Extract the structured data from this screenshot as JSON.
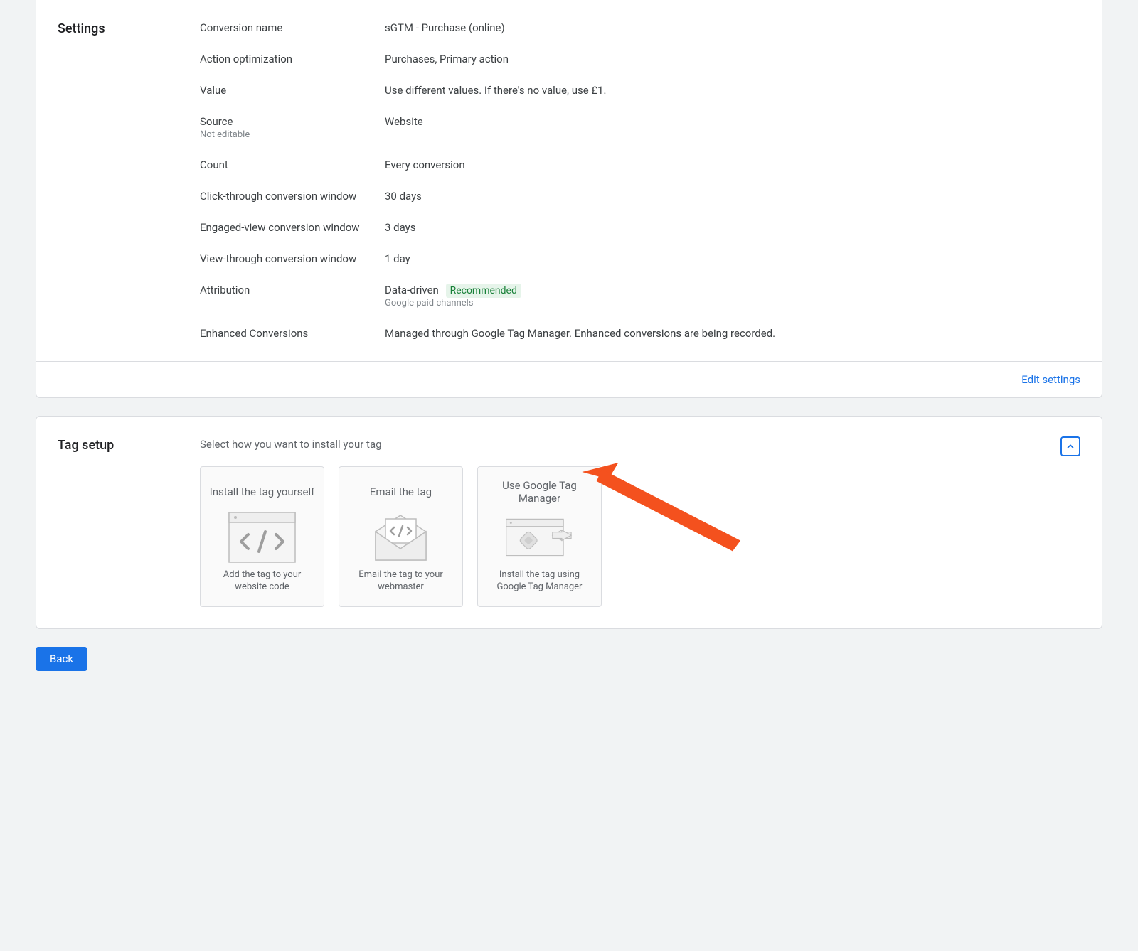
{
  "settings": {
    "title": "Settings",
    "rows": {
      "conversion_name": {
        "label": "Conversion name",
        "value": "sGTM - Purchase (online)"
      },
      "action_optimization": {
        "label": "Action optimization",
        "value": "Purchases, Primary action"
      },
      "value": {
        "label": "Value",
        "value": "Use different values. If there's no value, use £1."
      },
      "source": {
        "label": "Source",
        "sub": "Not editable",
        "value": "Website"
      },
      "count": {
        "label": "Count",
        "value": "Every conversion"
      },
      "click_through": {
        "label": "Click-through conversion window",
        "value": "30 days"
      },
      "engaged_view": {
        "label": "Engaged-view conversion window",
        "value": "3 days"
      },
      "view_through": {
        "label": "View-through conversion window",
        "value": "1 day"
      },
      "attribution": {
        "label": "Attribution",
        "value": "Data-driven",
        "badge": "Recommended",
        "sub": "Google paid channels"
      },
      "enhanced": {
        "label": "Enhanced Conversions",
        "value": "Managed through Google Tag Manager. Enhanced conversions are being recorded."
      }
    },
    "edit_link": "Edit settings"
  },
  "tag_setup": {
    "title": "Tag setup",
    "prompt": "Select how you want to install your tag",
    "options": [
      {
        "title": "Install the tag yourself",
        "desc": "Add the tag to your website code"
      },
      {
        "title": "Email the tag",
        "desc": "Email the tag to your webmaster"
      },
      {
        "title": "Use Google Tag Manager",
        "desc": "Install the tag using Google Tag Manager"
      }
    ]
  },
  "back_button": "Back"
}
